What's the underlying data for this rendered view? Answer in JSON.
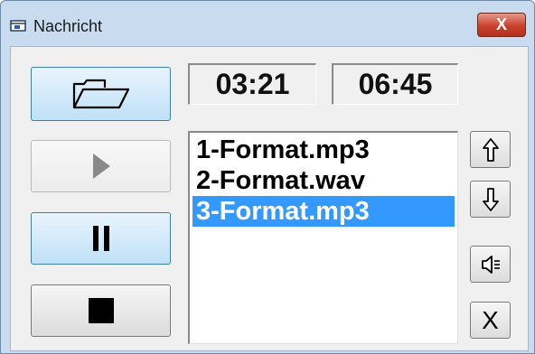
{
  "window": {
    "title": "Nachricht",
    "close_label": "X"
  },
  "player": {
    "time_elapsed": "03:21",
    "time_total": "06:45"
  },
  "playlist": {
    "tracks": [
      {
        "label": "1-Format.mp3"
      },
      {
        "label": "2-Format.wav"
      },
      {
        "label": "3-Format.mp3"
      }
    ],
    "selected_index": 2
  },
  "side_controls": {
    "remove_label": "X"
  },
  "icons": {
    "open": "folder-open-icon",
    "play": "play-icon",
    "pause": "pause-icon",
    "stop": "stop-icon",
    "up": "arrow-up-icon",
    "down": "arrow-down-icon",
    "volume": "speaker-icon"
  },
  "colors": {
    "title_bar": "#c9dcef",
    "close_button": "#c9412c",
    "selection": "#3399ff",
    "button_highlight": "#bfe0f7",
    "client_background": "#f0f0f0"
  }
}
